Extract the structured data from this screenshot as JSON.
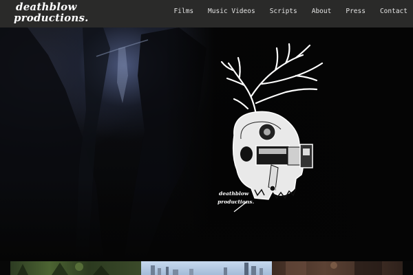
{
  "header": {
    "logo_line1": "deathblow",
    "logo_line2": "productions.",
    "nav": [
      {
        "label": "Films"
      },
      {
        "label": "Music Videos"
      },
      {
        "label": "Scripts"
      },
      {
        "label": "About"
      },
      {
        "label": "Press"
      },
      {
        "label": "Contact"
      }
    ]
  },
  "hero": {
    "emblem_line1": "deathblow",
    "emblem_line2": "productions."
  },
  "colors": {
    "header_bg": "#2a2a29",
    "page_bg": "#070707",
    "text": "#ffffff"
  },
  "icons": {
    "emblem": "antlered-skull-camera-icon"
  }
}
